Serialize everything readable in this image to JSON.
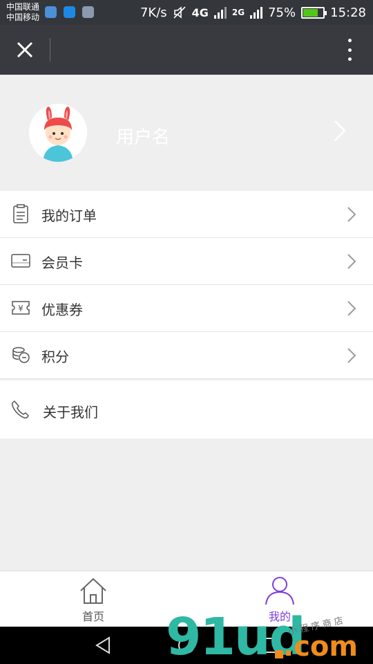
{
  "status_bar": {
    "carrier_1": "中国联通",
    "carrier_2": "中国移动",
    "speed": "7K/s",
    "network_1": "4G",
    "network_2": "2G",
    "battery_level": 75,
    "battery_text": "75%",
    "time": "15:28"
  },
  "header": {
    "close_icon": "close-icon",
    "more_icon": "more-vertical-icon"
  },
  "profile": {
    "username": "用户名",
    "avatar": "bunny-hat-avatar"
  },
  "menu": {
    "items": [
      {
        "label": "我的订单",
        "icon": "order-list-icon"
      },
      {
        "label": "会员卡",
        "icon": "member-card-icon"
      },
      {
        "label": "优惠券",
        "icon": "coupon-icon"
      },
      {
        "label": "积分",
        "icon": "points-coins-icon"
      }
    ],
    "about": {
      "label": "关于我们",
      "icon": "phone-icon"
    }
  },
  "tabbar": {
    "tabs": [
      {
        "label": "首页",
        "icon": "home-icon",
        "active": false
      },
      {
        "label": "我的",
        "icon": "user-icon",
        "active": true
      }
    ],
    "active_color": "#7c3ddc"
  },
  "watermark": {
    "brand": "91ud",
    "suffix": ".com",
    "tagline": "小程序商店"
  },
  "colors": {
    "status_bar": "#33363b",
    "app_bar": "#393a3f",
    "background": "#efefef",
    "accent": "#7c3ddc"
  }
}
